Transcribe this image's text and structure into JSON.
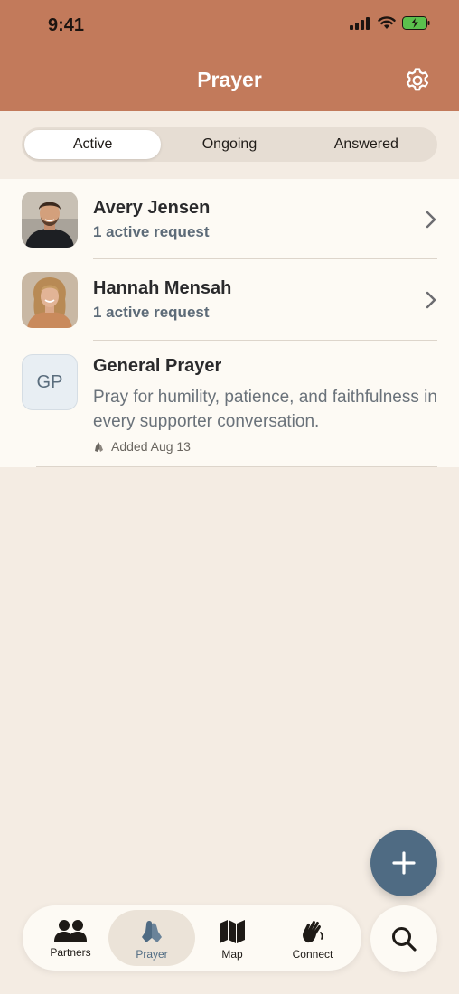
{
  "status_bar": {
    "time": "9:41"
  },
  "header": {
    "title": "Prayer"
  },
  "segments": [
    {
      "label": "Active",
      "selected": true
    },
    {
      "label": "Ongoing",
      "selected": false
    },
    {
      "label": "Answered",
      "selected": false
    }
  ],
  "partners": [
    {
      "name": "Avery Jensen",
      "subtitle": "1 active request"
    },
    {
      "name": "Hannah Mensah",
      "subtitle": "1 active request"
    }
  ],
  "general": {
    "initials": "GP",
    "title": "General Prayer",
    "description": "Pray for humility, patience, and faithfulness in every supporter conversation.",
    "added": "Added Aug 13"
  },
  "tabs": [
    {
      "label": "Partners",
      "icon": "people-icon"
    },
    {
      "label": "Prayer",
      "icon": "praying-hands-icon",
      "selected": true
    },
    {
      "label": "Map",
      "icon": "map-icon"
    },
    {
      "label": "Connect",
      "icon": "waving-hand-icon"
    }
  ],
  "colors": {
    "header": "#c27a5b",
    "accent": "#4f6b83",
    "background": "#f4ece3"
  }
}
